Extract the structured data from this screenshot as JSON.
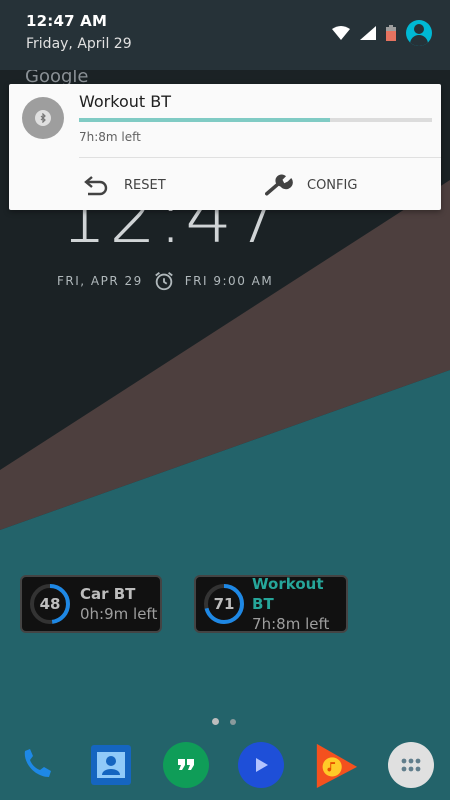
{
  "status_bar": {
    "time": "12:47 AM",
    "date": "Friday, April 29",
    "icons": [
      "wifi-icon",
      "signal-icon",
      "battery-icon",
      "avatar-icon"
    ]
  },
  "colors": {
    "accent": "#26a69a",
    "progress": "#80cbc4",
    "header_bg": "#263238",
    "bg_teal": "#23636a",
    "bg_brown": "#4d3f3e"
  },
  "background_search": "Google",
  "notification": {
    "title": "Workout BT",
    "progress": 0.71,
    "subtitle": "7h:8m left",
    "actions": [
      {
        "label": "RESET",
        "icon": "reset-icon"
      },
      {
        "label": "CONFIG",
        "icon": "wrench-icon"
      }
    ]
  },
  "lockscreen": {
    "clock": "12:47",
    "date": "FRI, APR 29",
    "alarm": "FRI 9:00 AM"
  },
  "widgets": [
    {
      "value": "48",
      "name": "Car BT",
      "left": "0h:9m left",
      "active": false,
      "fraction": 0.48
    },
    {
      "value": "71",
      "name": "Workout BT",
      "left": "7h:8m left",
      "active": true,
      "fraction": 0.71
    }
  ],
  "dock": [
    "phone-icon",
    "contacts-icon",
    "hangouts-icon",
    "play-movies-icon",
    "play-music-icon",
    "app-drawer-icon"
  ]
}
